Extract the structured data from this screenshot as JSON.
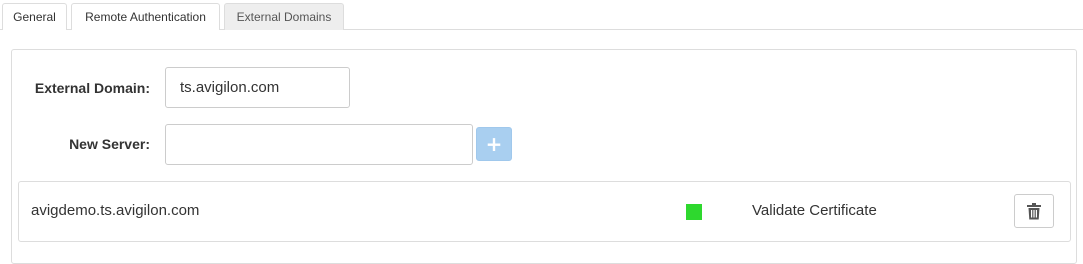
{
  "tabs": [
    {
      "label": "General",
      "active": false
    },
    {
      "label": "Remote Authentication",
      "active": false
    },
    {
      "label": "External Domains",
      "active": true
    }
  ],
  "form": {
    "external_domain_label": "External Domain:",
    "external_domain_value": "ts.avigilon.com",
    "new_server_label": "New Server:",
    "new_server_value": "",
    "add_button_icon": "plus-icon"
  },
  "servers": [
    {
      "name": "avigdemo.ts.avigilon.com",
      "status_color": "#2ed82e",
      "validate_label": "Validate Certificate",
      "delete_icon": "trash-icon"
    }
  ],
  "colors": {
    "add_button": "#a9cff0",
    "active_tab_bg": "#eeeeee"
  }
}
